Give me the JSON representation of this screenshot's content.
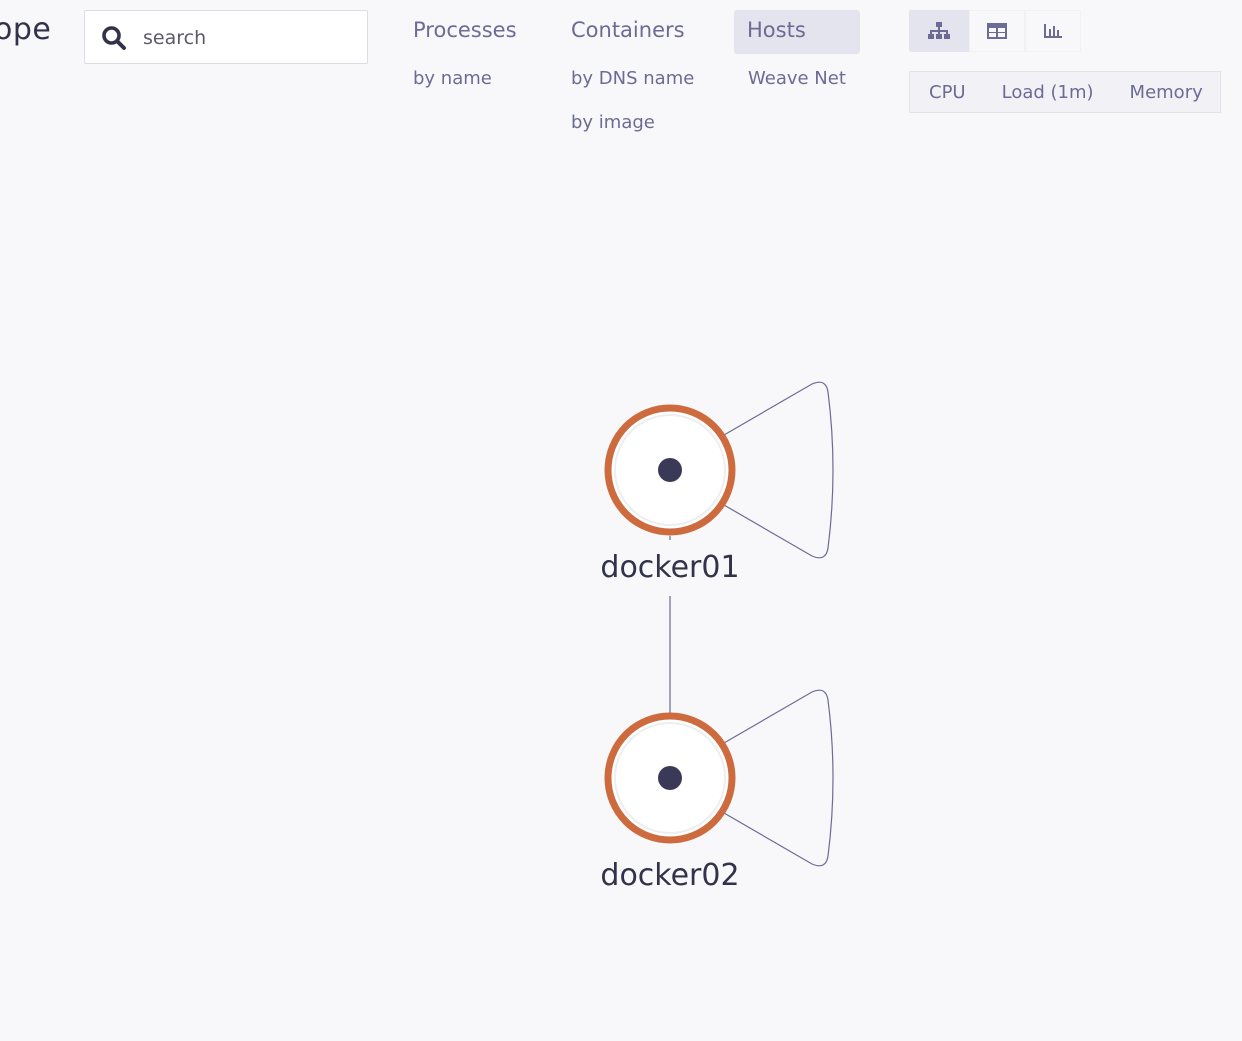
{
  "header": {
    "logo_fragment": "ope"
  },
  "search": {
    "placeholder": "search",
    "value": ""
  },
  "topologies": [
    {
      "label": "Processes",
      "sub": [
        "by name"
      ]
    },
    {
      "label": "Containers",
      "sub": [
        "by DNS name",
        "by image"
      ]
    },
    {
      "label": "Hosts",
      "active": true,
      "sub": [
        "Weave Net"
      ]
    }
  ],
  "view_modes": [
    {
      "icon": "graph-view-icon",
      "active": true
    },
    {
      "icon": "table-view-icon",
      "active": false
    },
    {
      "icon": "resource-view-icon",
      "active": false
    }
  ],
  "metrics": [
    "CPU",
    "Load (1m)",
    "Memory"
  ],
  "graph": {
    "nodes": [
      {
        "id": "docker01",
        "label": "docker01"
      },
      {
        "id": "docker02",
        "label": "docker02"
      }
    ],
    "edges": [
      {
        "from": "docker01",
        "to": "docker01"
      },
      {
        "from": "docker01",
        "to": "docker02"
      },
      {
        "from": "docker02",
        "to": "docker02"
      }
    ]
  },
  "colors": {
    "background": "#f8f8fa",
    "node_ring": "#cd6b3e",
    "node_center": "#3a3a58",
    "edge": "#6b6b95",
    "text_primary": "#32324b",
    "text_nav": "#6b6b95",
    "active_bg": "#e4e4ee"
  }
}
